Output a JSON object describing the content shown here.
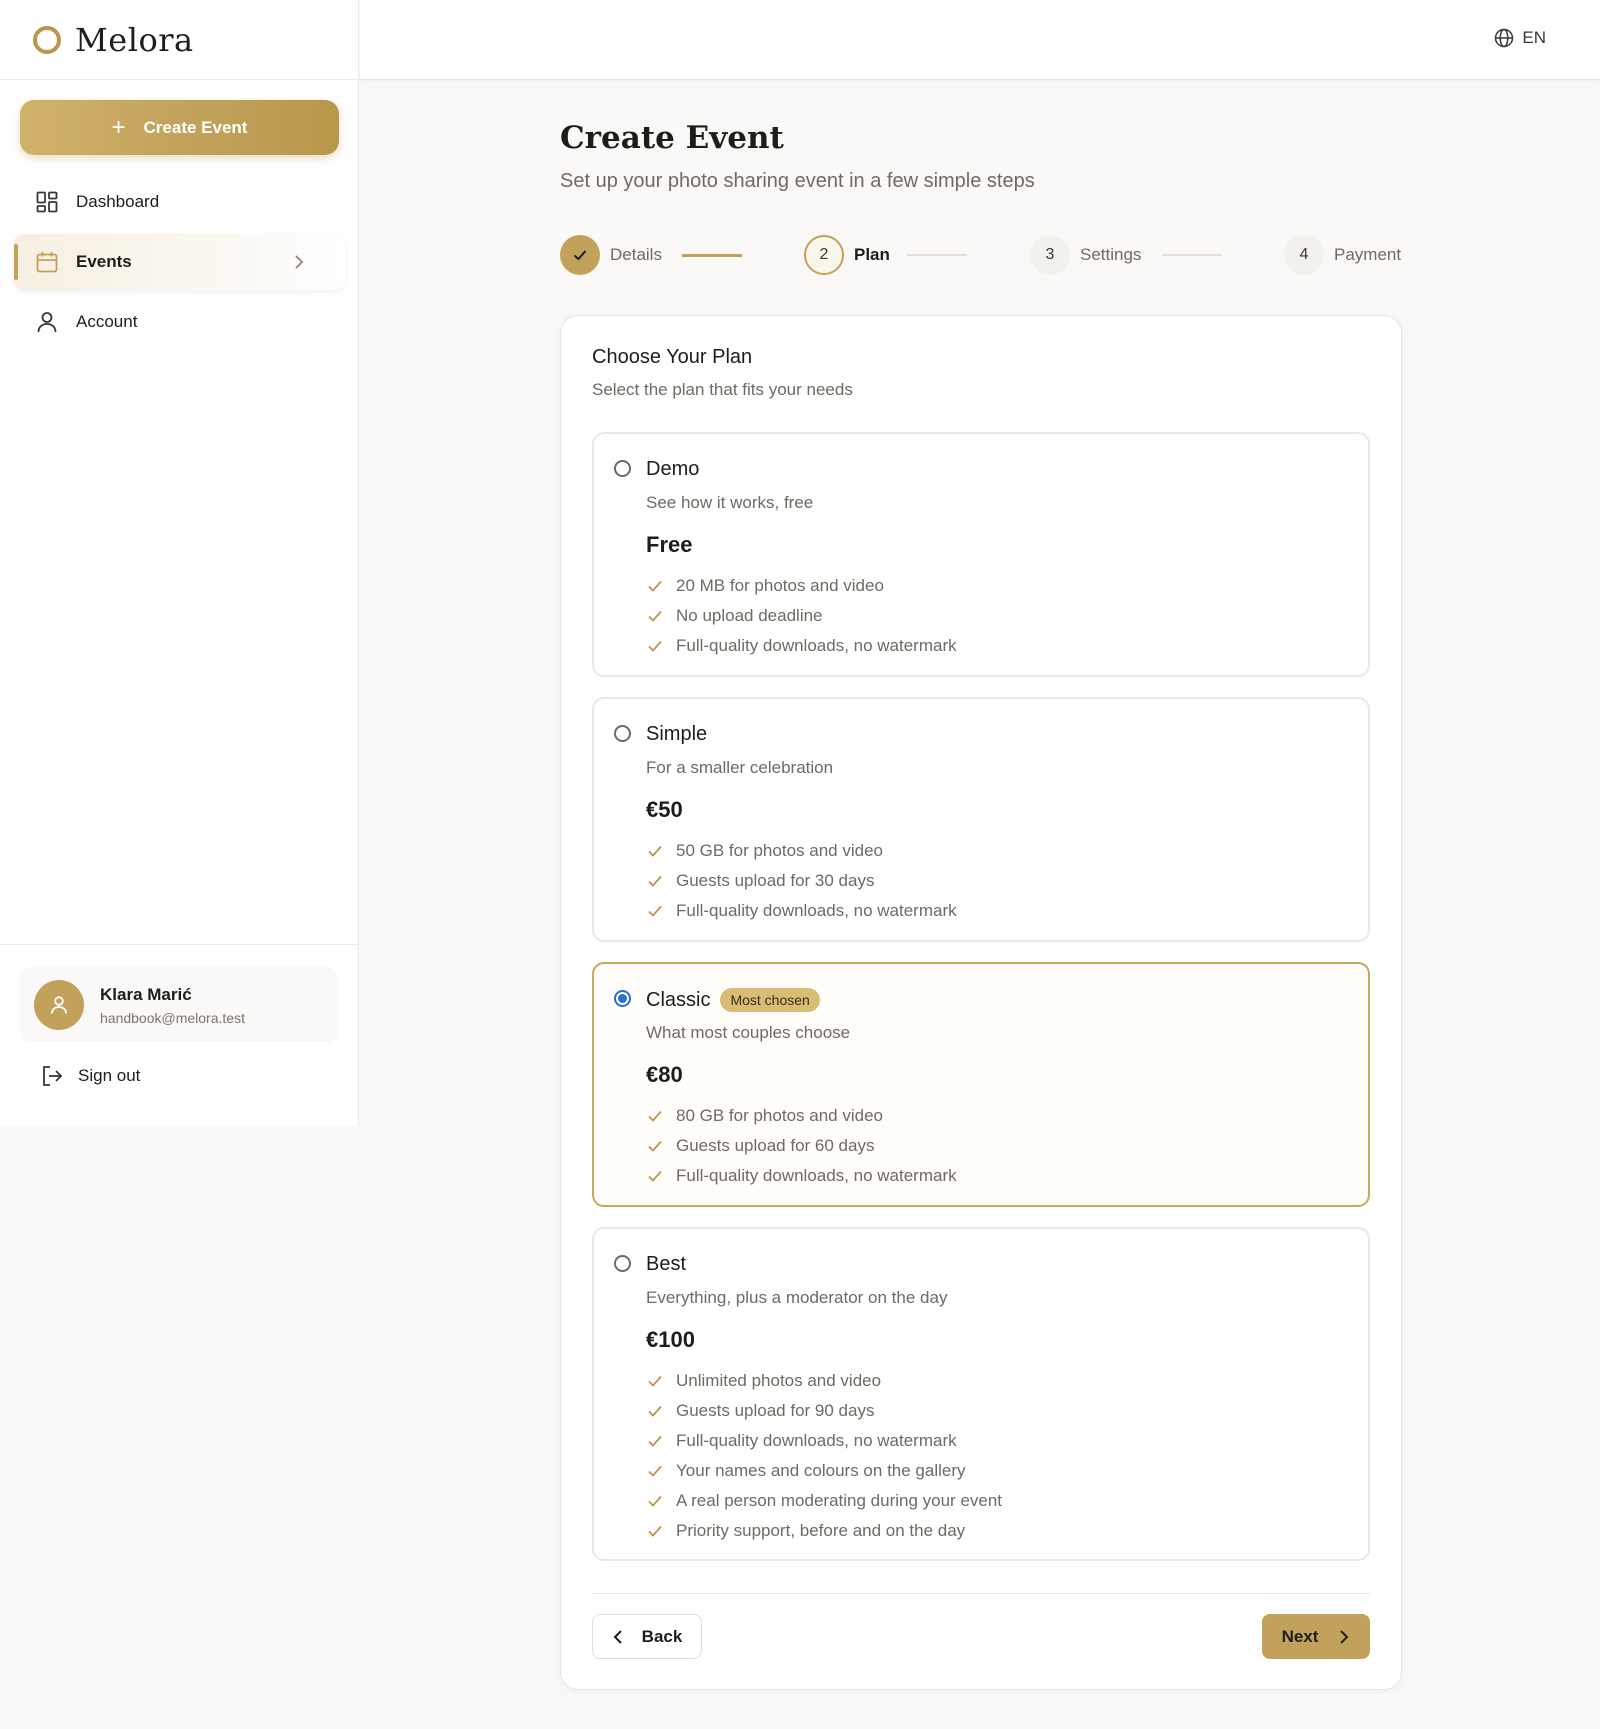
{
  "brand": {
    "name": "Melora",
    "accent": "#c2a25a"
  },
  "sidebar": {
    "create_label": "Create Event",
    "items": [
      {
        "label": "Dashboard",
        "icon": "dashboard-icon"
      },
      {
        "label": "Events",
        "icon": "calendar-icon"
      },
      {
        "label": "Account",
        "icon": "user-icon"
      }
    ],
    "user": {
      "name": "Klara Marić",
      "email": "handbook@melora.test"
    },
    "signout_label": "Sign out"
  },
  "topbar": {
    "language": "EN"
  },
  "page": {
    "title": "Create Event",
    "subtitle": "Set up your photo sharing event in a few simple steps"
  },
  "stepper": {
    "steps": [
      {
        "number": "1",
        "label": "Details",
        "state": "done"
      },
      {
        "number": "2",
        "label": "Plan",
        "state": "current"
      },
      {
        "number": "3",
        "label": "Settings",
        "state": "upcoming"
      },
      {
        "number": "4",
        "label": "Payment",
        "state": "upcoming"
      }
    ]
  },
  "plan_card": {
    "title": "Choose Your Plan",
    "subtitle": "Select the plan that fits your needs",
    "plans": [
      {
        "name": "Demo",
        "description": "See how it works, free",
        "price": "Free",
        "features": [
          "20 MB for photos and video",
          "No upload deadline",
          "Full-quality downloads, no watermark"
        ]
      },
      {
        "name": "Simple",
        "description": "For a smaller celebration",
        "price": "€50",
        "features": [
          "50 GB for photos and video",
          "Guests upload for 30 days",
          "Full-quality downloads, no watermark"
        ]
      },
      {
        "name": "Classic",
        "badge": "Most chosen",
        "selected": true,
        "description": "What most couples choose",
        "price": "€80",
        "features": [
          "80 GB for photos and video",
          "Guests upload for 60 days",
          "Full-quality downloads, no watermark"
        ]
      },
      {
        "name": "Best",
        "description": "Everything, plus a moderator on the day",
        "price": "€100",
        "features": [
          "Unlimited photos and video",
          "Guests upload for 90 days",
          "Full-quality downloads, no watermark",
          "Your names and colours on the gallery",
          "A real person moderating during your event",
          "Priority support, before and on the day"
        ]
      }
    ],
    "back_label": "Back",
    "next_label": "Next"
  }
}
